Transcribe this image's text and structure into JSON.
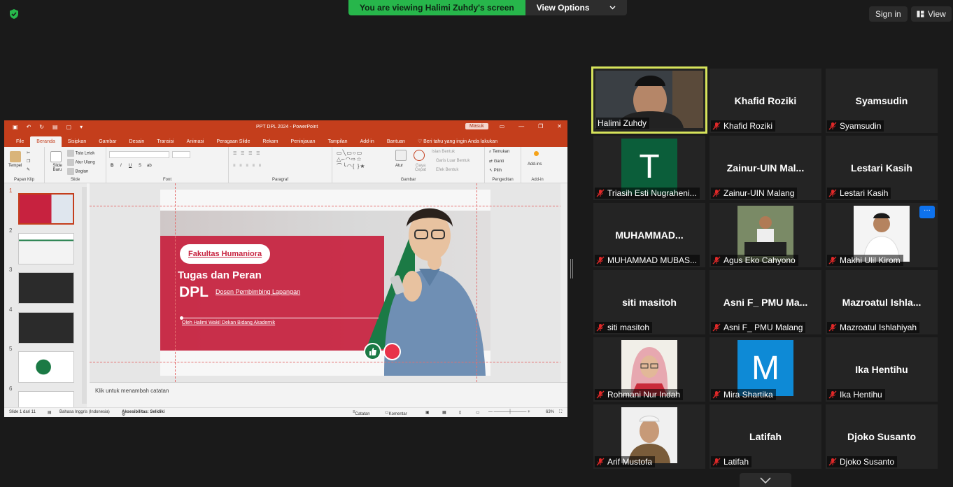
{
  "banner": {
    "viewing": "You are viewing Halimi Zuhdy's screen",
    "view_options": "View Options"
  },
  "topright": {
    "sign_in": "Sign in",
    "view": "View"
  },
  "ppt": {
    "doc_title": "PPT DPL 2024  -  PowerPoint",
    "masuk": "Masuk",
    "tabs": [
      "File",
      "Beranda",
      "Sisipkan",
      "Gambar",
      "Desain",
      "Transisi",
      "Animasi",
      "Peragaan Slide",
      "Rekam",
      "Peninjauan",
      "Tampilan",
      "Add-in",
      "Bantuan"
    ],
    "tell_me": "Beri tahu yang ingin Anda lakukan",
    "ribbon": {
      "tempel": "Tempel",
      "papan_klip": "Papan Klip",
      "slide_baru": "Slide Baru",
      "tata_letak": "Tata Letak",
      "atur_ulang": "Atur Ulang",
      "bagian": "Bagian",
      "slide_group": "Slide",
      "font_group": "Font",
      "paragraf_group": "Paragraf",
      "atur": "Atur",
      "gaya_cepat": "Gaya Cepat",
      "isian_bentuk": "Isian Bentuk",
      "garis_luar": "Garis Luar Bentuk",
      "efek_bentuk": "Efek Bentuk",
      "gambar_group": "Gambar",
      "temukan": "Temukan",
      "ganti": "Ganti",
      "pilih": "Pilih",
      "pengeditan_group": "Pengeditan",
      "add_ins": "Add-ins",
      "addin_group": "Add-in"
    },
    "thumb_numbers": [
      "1",
      "2",
      "3",
      "4",
      "5",
      "6"
    ],
    "slide": {
      "pill": "Fakultas Humaniora",
      "line1": "Tugas dan Peran",
      "line2": "DPL",
      "line2_sub": "Dosen Pembimbing Lapangan",
      "byline": "Oleh Halimi Wakil Dekan Bidang Akademik"
    },
    "notes_placeholder": "Klik untuk menambah catatan",
    "status": {
      "slide": "Slide 1 dari 11",
      "lang": "Bahasa Inggris (Indonesia)",
      "access": "Aksesibilitas: Selidiki",
      "catatan": "Catatan",
      "komentar": "Komentar",
      "zoom": "63%"
    }
  },
  "participants": [
    {
      "name": "Halimi Zuhdy",
      "tile": "",
      "type": "video"
    },
    {
      "name": "Khafid Roziki",
      "tile": "Khafid Roziki",
      "type": "name"
    },
    {
      "name": "Syamsudin",
      "tile": "Syamsudin",
      "type": "name"
    },
    {
      "name": "Triasih Esti Nugraheni...",
      "tile": "T",
      "type": "letter",
      "color": "#0b5e3a"
    },
    {
      "name": "Zainur-UIN Malang",
      "tile": "Zainur-UIN  Mal...",
      "type": "name"
    },
    {
      "name": "Lestari Kasih",
      "tile": "Lestari Kasih",
      "type": "name"
    },
    {
      "name": "MUHAMMAD MUBAS...",
      "tile": "MUHAMMAD...",
      "type": "name"
    },
    {
      "name": "Agus Eko Cahyono",
      "tile": "",
      "type": "photo"
    },
    {
      "name": "Makhi Ulil Kirom",
      "tile": "",
      "type": "photo"
    },
    {
      "name": "siti masitoh",
      "tile": "siti masitoh",
      "type": "name"
    },
    {
      "name": "Asni F_ PMU Malang",
      "tile": "Asni F_ PMU Ma...",
      "type": "name"
    },
    {
      "name": "Mazroatul Ishlahiyah",
      "tile": "Mazroatul  Ishla...",
      "type": "name"
    },
    {
      "name": "Rohmani Nur Indah",
      "tile": "",
      "type": "photo"
    },
    {
      "name": "Mira Shartika",
      "tile": "M",
      "type": "letter",
      "color": "#0e8ad6"
    },
    {
      "name": "Ika Hentihu",
      "tile": "Ika Hentihu",
      "type": "name"
    },
    {
      "name": "Arif Mustofa",
      "tile": "",
      "type": "photo"
    },
    {
      "name": "Latifah",
      "tile": "Latifah",
      "type": "name"
    },
    {
      "name": "Djoko Susanto",
      "tile": "Djoko Susanto",
      "type": "name"
    }
  ],
  "more_icon": "···",
  "colors": {
    "banner_green": "#27b64b",
    "ppt_red": "#c43e1c",
    "active_border": "#d6e35b",
    "muted_mic": "#e02828"
  }
}
